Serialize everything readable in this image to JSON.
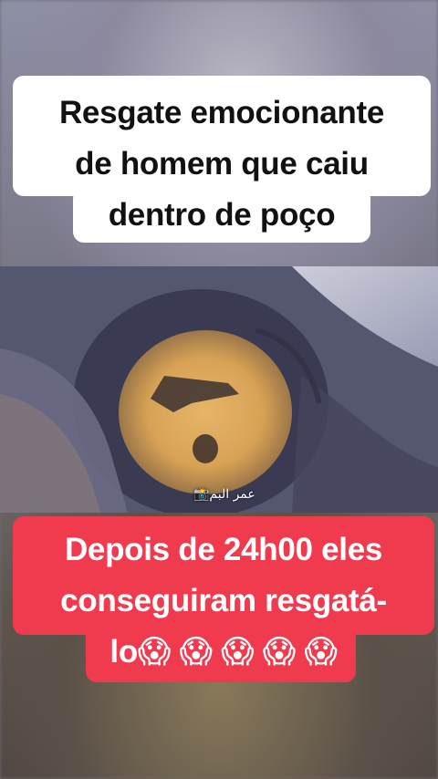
{
  "title": {
    "line1": "Resgate emocionante",
    "line2": "de homem  que caiu",
    "line3": "dentro de poço"
  },
  "caption": {
    "line1": "Depois de 24h00 eles",
    "line2": "conseguiram resgatá-",
    "line3": "lo😱 😱 😱 😱 😱"
  },
  "video": {
    "watermark": "عمر البم📸"
  },
  "colors": {
    "caption_bg": "#f03b4f",
    "title_bg": "#ffffff"
  }
}
